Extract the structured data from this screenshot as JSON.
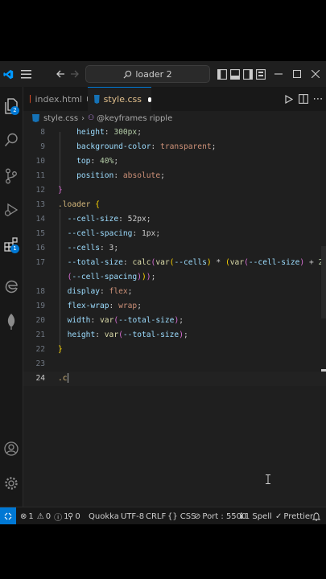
{
  "titlebar": {
    "command_center": "loader 2"
  },
  "activity": {
    "explorer_badge": "2",
    "extensions_badge": "1"
  },
  "tabs": [
    {
      "label": "index.html"
    },
    {
      "label": "style.css"
    }
  ],
  "breadcrumb": {
    "file": "style.css",
    "symbol": "@keyframes ripple"
  },
  "editor": {
    "lines": [
      {
        "n": "8",
        "code": "    height: 300px;"
      },
      {
        "n": "9",
        "code": "    background-color: transparent;"
      },
      {
        "n": "10",
        "code": "    top: 40%;"
      },
      {
        "n": "11",
        "code": "    position: absolute;"
      },
      {
        "n": "12",
        "code": "}"
      },
      {
        "n": "13",
        "code": ".loader {"
      },
      {
        "n": "14",
        "code": "  --cell-size: 52px;"
      },
      {
        "n": "15",
        "code": "  --cell-spacing: 1px;"
      },
      {
        "n": "16",
        "code": "  --cells: 3;"
      },
      {
        "n": "17",
        "code": "  --total-size: calc(var(--cells) * (var(--cell-size) + 2 * var"
      },
      {
        "n": "",
        "code": "  (--cell-spacing)));"
      },
      {
        "n": "18",
        "code": "  display: flex;"
      },
      {
        "n": "19",
        "code": "  flex-wrap: wrap;"
      },
      {
        "n": "20",
        "code": "  width: var(--total-size);"
      },
      {
        "n": "21",
        "code": "  height: var(--total-size);"
      },
      {
        "n": "22",
        "code": "}"
      },
      {
        "n": "23",
        "code": ""
      },
      {
        "n": "24",
        "code": ".c"
      }
    ]
  },
  "statusbar": {
    "errors": "1",
    "warnings": "0",
    "info": "1",
    "ports_count": "0",
    "quokka": "Quokka",
    "encoding": "UTF-8",
    "eol": "CRLF",
    "language": "CSS",
    "port": "Port : 5500",
    "spell": "1 Spell",
    "prettier": "Prettier"
  },
  "colors": {
    "accent": "#0078d4",
    "editor_bg": "#1f1f1f",
    "html_icon": "#e44d26",
    "css_icon": "#1572b6"
  }
}
